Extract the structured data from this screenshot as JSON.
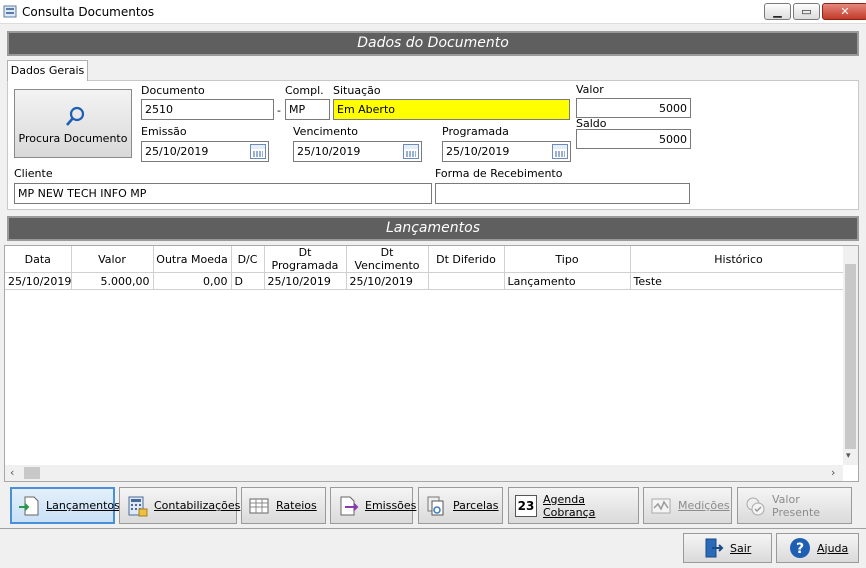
{
  "window": {
    "title": "Consulta Documentos"
  },
  "documento_section": {
    "header": "Dados do Documento",
    "tab": "Dados Gerais",
    "procura_button": "Procura Documento",
    "documento_label": "Documento",
    "documento_value": "2510",
    "separator": "-",
    "compl_label": "Compl.",
    "compl_value": "MP",
    "situacao_label": "Situação",
    "situacao_value": "Em Aberto",
    "valor_label": "Valor",
    "valor_value": "5000",
    "saldo_label": "Saldo",
    "saldo_value": "5000",
    "emissao_label": "Emissão",
    "emissao_value": "25/10/2019",
    "vencimento_label": "Vencimento",
    "vencimento_value": "25/10/2019",
    "programada_label": "Programada",
    "programada_value": "25/10/2019",
    "cliente_label": "Cliente",
    "cliente_value": "MP NEW TECH INFO MP",
    "forma_label": "Forma de Recebimento",
    "forma_value": ""
  },
  "lancamentos_section": {
    "header": "Lançamentos",
    "columns": [
      "Data",
      "Valor",
      "Outra Moeda",
      "D/C",
      "Dt Programada",
      "Dt Vencimento",
      "Dt Diferido",
      "Tipo",
      "Histórico"
    ],
    "rows": [
      {
        "data": "25/10/2019",
        "valor": "5.000,00",
        "outra_moeda": "0,00",
        "dc": "D",
        "dt_programada": "25/10/2019",
        "dt_vencimento": "25/10/2019",
        "dt_diferido": "",
        "tipo": "Lançamento",
        "historico": "Teste"
      }
    ]
  },
  "toolbar": {
    "lancamentos": "Lançamentos",
    "contabilizacoes": "Contabilizações",
    "rateios": "Rateios",
    "emissoes": "Emissões",
    "parcelas": "Parcelas",
    "agenda": "Agenda Cobrança",
    "agenda_icon_number": "23",
    "medicoes": "Medições",
    "valor_presente": "Valor Presente"
  },
  "footer": {
    "sair": "Sair",
    "ajuda": "Ajuda"
  },
  "colors": {
    "situacao_bg": "#ffff00",
    "section_header_bg": "#5f5f5f",
    "active_button_border": "#4a90d9"
  }
}
